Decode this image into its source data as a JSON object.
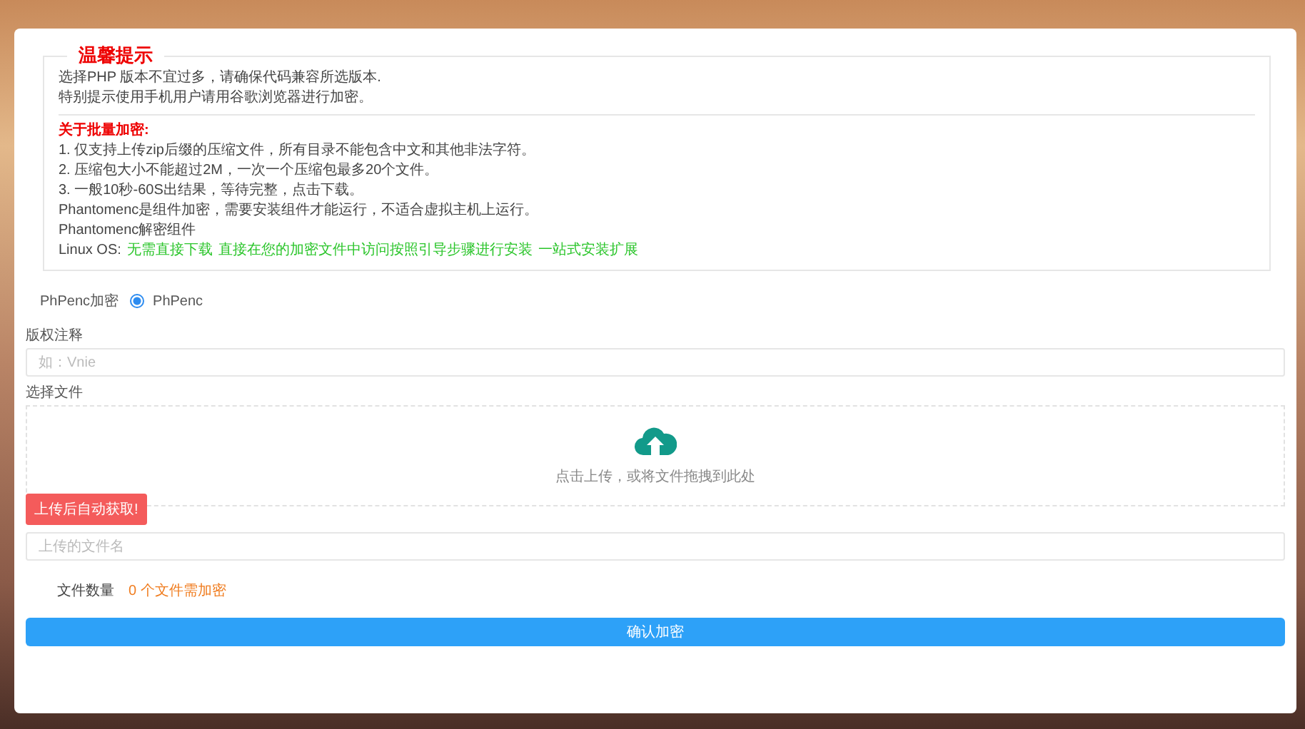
{
  "notice": {
    "title": "温馨提示",
    "intro": [
      "选择PHP 版本不宜过多，请确保代码兼容所选版本.",
      "特别提示使用手机用户请用谷歌浏览器进行加密。"
    ],
    "batch_heading": "关于批量加密:",
    "items": [
      "1. 仅支持上传zip后缀的压缩文件，所有目录不能包含中文和其他非法字符。",
      "2. 压缩包大小不能超过2M，一次一个压缩包最多20个文件。",
      "3. 一般10秒-60S出结果，等待完整，点击下载。",
      "Phantomenc是组件加密，需要安装组件才能运行，不适合虚拟主机上运行。",
      "Phantomenc解密组件"
    ],
    "linux": {
      "label": "Linux OS:",
      "links": [
        "无需直接下载",
        "直接在您的加密文件中访问按照引导步骤进行安装",
        "一站式安装扩展"
      ]
    }
  },
  "encryption": {
    "label": "PhPenc加密",
    "options": [
      {
        "label": "PhPenc",
        "selected": true
      }
    ]
  },
  "copyright": {
    "label": "版权注释",
    "placeholder": "如：Vnie"
  },
  "file": {
    "label": "选择文件",
    "hint": "点击上传，或将文件拖拽到此处",
    "tooltip": "上传后自动获取!",
    "filename_placeholder": "上传的文件名"
  },
  "count": {
    "label": "文件数量",
    "value": "0 个文件需加密"
  },
  "submit": "确认加密"
}
